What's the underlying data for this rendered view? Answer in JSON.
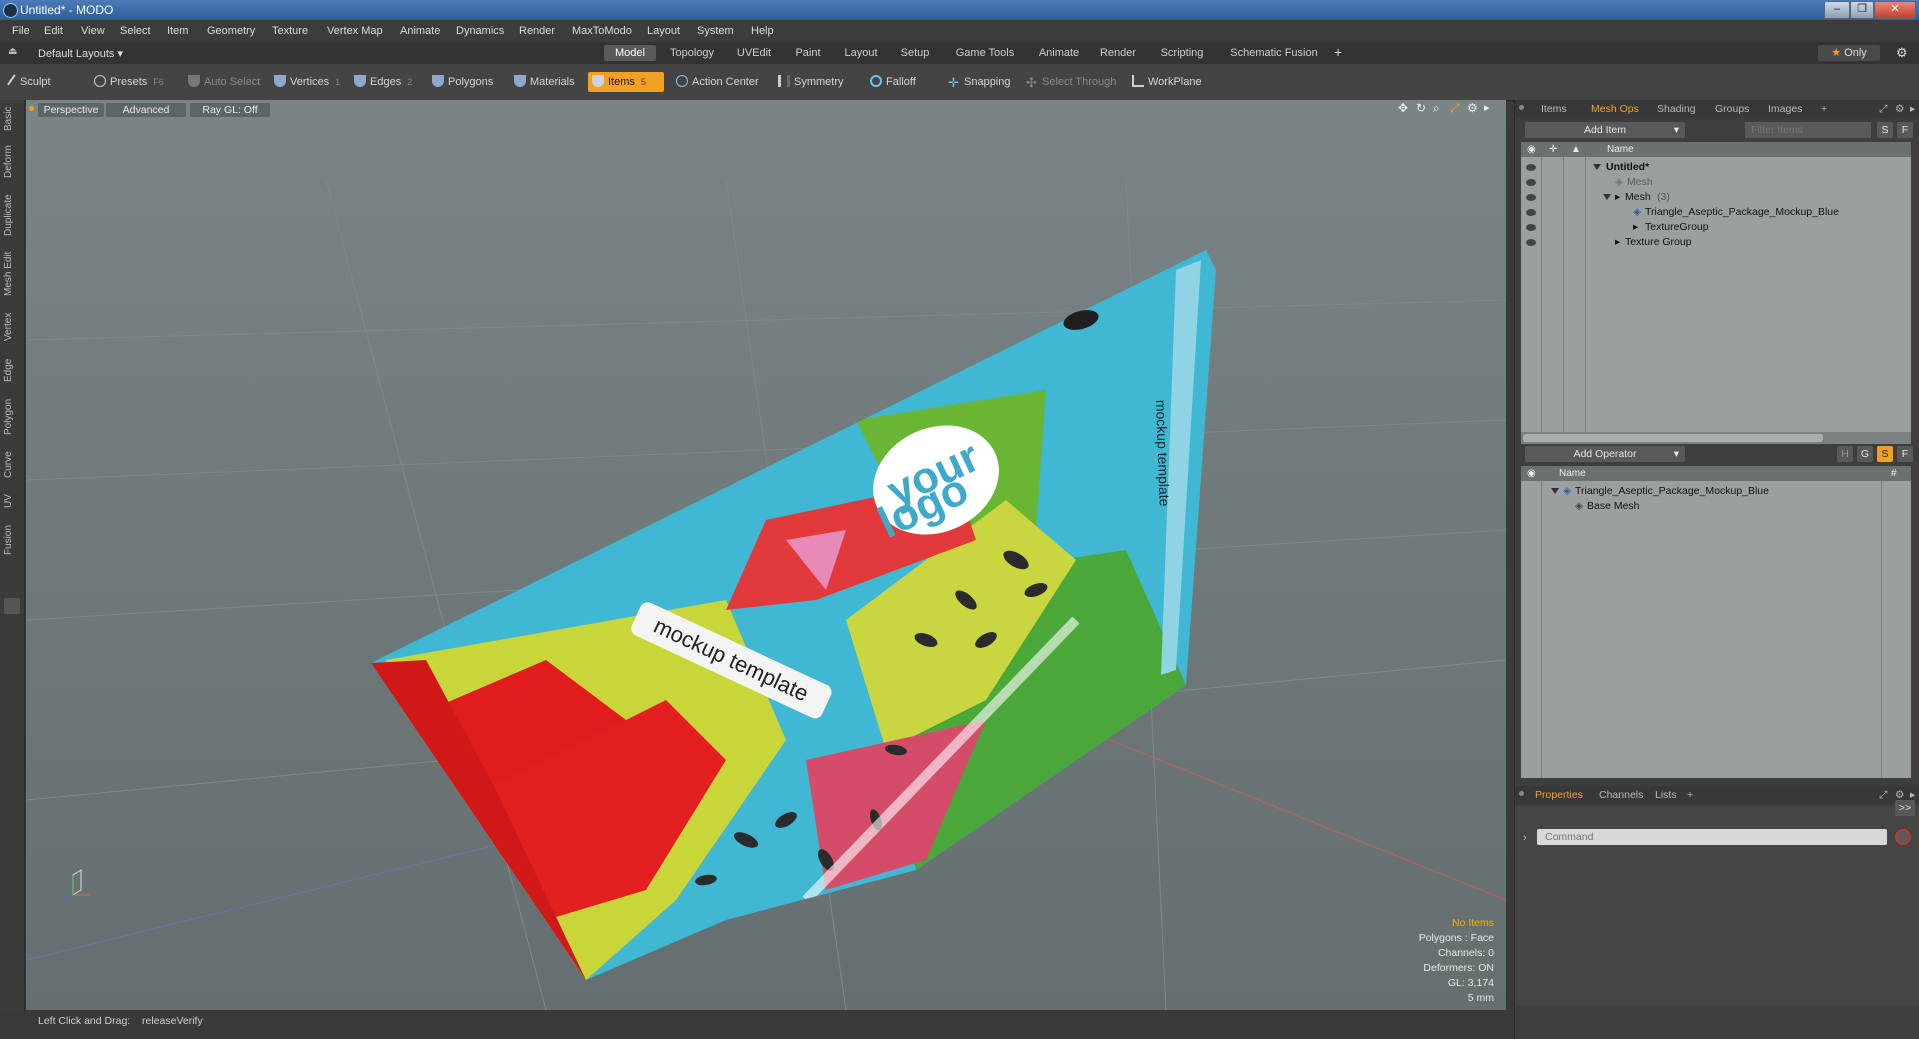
{
  "window": {
    "title": "Untitled* - MODO"
  },
  "menus": [
    "File",
    "Edit",
    "View",
    "Select",
    "Item",
    "Geometry",
    "Texture",
    "Vertex Map",
    "Animate",
    "Dynamics",
    "Render",
    "MaxToModo",
    "Layout",
    "System",
    "Help"
  ],
  "layout": {
    "preset": "Default Layouts",
    "tabs": [
      "Model",
      "Topology",
      "UVEdit",
      "Paint",
      "Layout",
      "Setup",
      "Game Tools",
      "Animate",
      "Render",
      "Scripting",
      "Schematic Fusion"
    ],
    "active_tab": "Model",
    "only_label": "Only"
  },
  "toolbar": {
    "sculpt": "Sculpt",
    "presets": "Presets",
    "presets_key": "F6",
    "auto_select": "Auto Select",
    "vertices": "Vertices",
    "vertices_key": "1",
    "edges": "Edges",
    "edges_key": "2",
    "polygons": "Polygons",
    "materials": "Materials",
    "items": "Items",
    "items_key": "5",
    "action_center": "Action Center",
    "symmetry": "Symmetry",
    "falloff": "Falloff",
    "snapping": "Snapping",
    "select_through": "Select Through",
    "workplane": "WorkPlane"
  },
  "left_tabs": [
    "Basic",
    "Deform",
    "Duplicate",
    "Mesh Edit",
    "Vertex",
    "Edge",
    "Polygon",
    "Curve",
    "UV",
    "Fusion"
  ],
  "viewport": {
    "view": "Perspective",
    "shading": "Advanced",
    "raygl": "Ray GL: Off",
    "info": {
      "no_items": "No Items",
      "polygons": "Polygons : Face",
      "channels": "Channels: 0",
      "deformers": "Deformers: ON",
      "gl": "GL: 3,174",
      "scale": "5 mm"
    },
    "package_texts": {
      "logo_line1": "your",
      "logo_line2": "logo",
      "label": "mockup template",
      "side": "mockup template"
    }
  },
  "status": {
    "hint_key": "Left Click and Drag:",
    "hint_value": "releaseVerify"
  },
  "items_panel": {
    "tabs": [
      "Items",
      "Mesh Ops",
      "Shading",
      "Groups",
      "Images"
    ],
    "active_tab": "Mesh Ops",
    "add_item": "Add Item",
    "filter_placeholder": "Filter Items",
    "btn_s": "S",
    "btn_f": "F",
    "col_name": "Name",
    "tree": [
      {
        "label": "Untitled*",
        "depth": 0,
        "bold": true
      },
      {
        "label": "Mesh",
        "depth": 1,
        "grey": true
      },
      {
        "label": "Mesh",
        "count": "(3)",
        "depth": 1
      },
      {
        "label": "Triangle_Aseptic_Package_Mockup_Blue",
        "depth": 2
      },
      {
        "label": "TextureGroup",
        "depth": 2
      },
      {
        "label": "Texture Group",
        "depth": 1
      }
    ]
  },
  "operator_panel": {
    "add_operator": "Add Operator",
    "btn_h": "H",
    "btn_g": "G",
    "btn_s": "S",
    "btn_f": "F",
    "col_name": "Name",
    "col_hash": "#",
    "tree": [
      {
        "label": "Triangle_Aseptic_Package_Mockup_Blue"
      },
      {
        "label": "Base Mesh"
      }
    ]
  },
  "properties_panel": {
    "tabs": [
      "Properties",
      "Channels",
      "Lists"
    ],
    "active_tab": "Properties",
    "expand_label": ">>",
    "command_placeholder": "Command"
  },
  "colors": {
    "accent": "#f2a024",
    "viewport_bg": "#6e7878",
    "panel_bg": "#9aa0a0"
  }
}
